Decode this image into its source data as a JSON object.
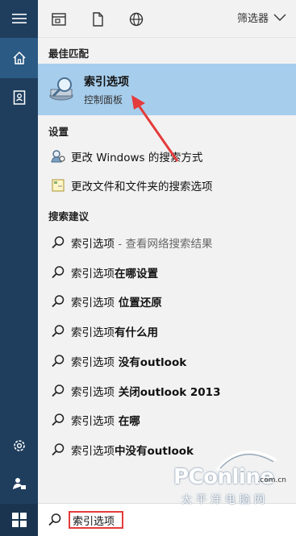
{
  "topbar": {
    "filter_label": "筛选器"
  },
  "sections": {
    "best_match": "最佳匹配",
    "settings": "设置",
    "suggestions": "搜索建议"
  },
  "best_match": {
    "title": "索引选项",
    "subtitle": "控制面板"
  },
  "settings_items": [
    {
      "label": "更改 Windows 的搜索方式"
    },
    {
      "label": "更改文件和文件夹的搜索选项"
    }
  ],
  "suggestions": [
    {
      "prefix": "索引选项",
      "bold": "",
      "muted": " - 查看网络搜索结果"
    },
    {
      "prefix": "索引选项",
      "bold": "在哪设置",
      "muted": ""
    },
    {
      "prefix": "索引选项",
      "bold": " 位置还原",
      "muted": ""
    },
    {
      "prefix": "索引选项",
      "bold": "有什么用",
      "muted": ""
    },
    {
      "prefix": "索引选项",
      "bold": " 没有outlook",
      "muted": ""
    },
    {
      "prefix": "索引选项",
      "bold": " 关闭outlook 2013",
      "muted": ""
    },
    {
      "prefix": "索引选项",
      "bold": " 在哪",
      "muted": ""
    },
    {
      "prefix": "索引选项",
      "bold": "中没有outlook",
      "muted": ""
    }
  ],
  "search": {
    "value": "索引选项"
  },
  "watermark": {
    "logo": "PConline",
    "domain": ".com.cn",
    "cn": "太平洋电脑网"
  },
  "colors": {
    "rail": "#1f3e5e",
    "highlight": "#a7cdec",
    "annotation": "#e43b3b"
  }
}
